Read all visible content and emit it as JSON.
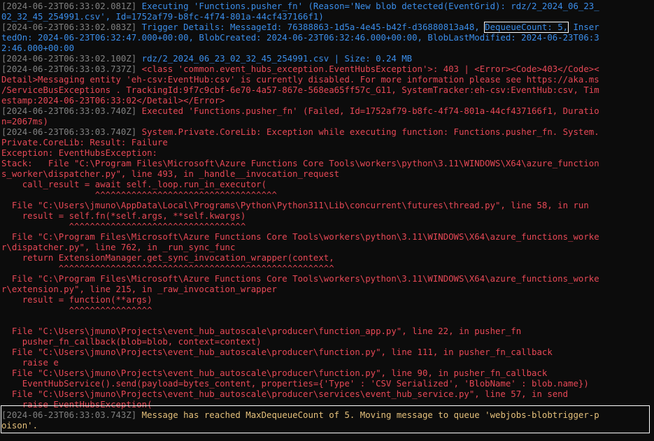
{
  "terminal": {
    "executing": {
      "ts": "[2024-06-23T06:33:02.081Z]",
      "line1": " Executing 'Functions.pusher_fn' (Reason='New blob detected(EventGrid): rdz/2_2024_06_23_",
      "line2": "02_32_45_254991.csv', Id=1752af79-b8fc-4f74-801a-44cf437166f1)"
    },
    "trigger": {
      "ts": "[2024-06-23T06:33:02.083Z]",
      "pre": " Trigger Details: MessageId: 76388863-1d5a-4e45-b42f-d36880813a48, ",
      "dequeue": "DequeueCount: 5,",
      "post": " Inser",
      "line2": "tedOn: 2024-06-23T06:32:47.000+00:00, BlobCreated: 2024-06-23T06:32:46.000+00:00, BlobLastModified: 2024-06-23T06:3",
      "line3": "2:46.000+00:00"
    },
    "blob": {
      "ts": "[2024-06-23T06:33:02.100Z]",
      "text": " rdz/2_2024_06_23_02_32_45_254991.csv | Size: 0.24 MB"
    },
    "exception": {
      "ts": "[2024-06-23T06:33:03.737Z]",
      "line1": " <class 'common.event_hubs_exception.EventHubsException'>: 403 | <Error><Code>403</Code><",
      "line2": "Detail>Messaging entity 'eh-csv:EventHub:csv' is currently disabled. For more information please see https://aka.ms",
      "line3": "/ServiceBusExceptions . TrackingId:9f7c9cbf-6e70-4a57-867e-568ea65ff57c_G11, SystemTracker:eh-csv:EventHub:csv, Tim",
      "line4": "estamp:2024-06-23T06:33:02</Detail></Error>"
    },
    "executed": {
      "ts": "[2024-06-23T06:33:03.740Z]",
      "line1": " Executed 'Functions.pusher_fn' (Failed, Id=1752af79-b8fc-4f74-801a-44cf437166f1, Duratio",
      "line2": "n=2067ms)"
    },
    "system": {
      "ts": "[2024-06-23T06:33:03.740Z]",
      "line1": " System.Private.CoreLib: Exception while executing function: Functions.pusher_fn. System.",
      "lines": [
        "Private.CoreLib: Result: Failure",
        "Exception: EventHubsException:",
        "Stack:   File \"C:\\Program Files\\Microsoft\\Azure Functions Core Tools\\workers\\python\\3.11\\WINDOWS\\X64\\azure_function",
        "s_worker\\dispatcher.py\", line 493, in _handle__invocation_request",
        "    call_result = await self._loop.run_in_executor(",
        "                  ^^^^^^^^^^^^^^^^^^^^^^^^^^^^^^^^^^^",
        "  File \"C:\\Users\\jmuno\\AppData\\Local\\Programs\\Python\\Python311\\Lib\\concurrent\\futures\\thread.py\", line 58, in run",
        "    result = self.fn(*self.args, **self.kwargs)",
        "             ^^^^^^^^^^^^^^^^^^^^^^^^^^^^^^^^^^",
        "  File \"C:\\Program Files\\Microsoft\\Azure Functions Core Tools\\workers\\python\\3.11\\WINDOWS\\X64\\azure_functions_worke",
        "r\\dispatcher.py\", line 762, in _run_sync_func",
        "    return ExtensionManager.get_sync_invocation_wrapper(context,",
        "           ^^^^^^^^^^^^^^^^^^^^^^^^^^^^^^^^^^^^^^^^^^^^^^^^^^^^^",
        "  File \"C:\\Program Files\\Microsoft\\Azure Functions Core Tools\\workers\\python\\3.11\\WINDOWS\\X64\\azure_functions_worke",
        "r\\extension.py\", line 215, in _raw_invocation_wrapper",
        "    result = function(**args)",
        "             ^^^^^^^^^^^^^^^^",
        "",
        "  File \"C:\\Users\\jmuno\\Projects\\event_hub_autoscale\\producer\\function_app.py\", line 22, in pusher_fn",
        "    pusher_fn_callback(blob=blob, context=context)",
        "  File \"C:\\Users\\jmuno\\Projects\\event_hub_autoscale\\producer\\function.py\", line 111, in pusher_fn_callback",
        "    raise e",
        "  File \"C:\\Users\\jmuno\\Projects\\event_hub_autoscale\\producer\\function.py\", line 90, in pusher_fn_callback",
        "    EventHubService().send(payload=bytes_content, properties={'Type' : 'CSV Serialized', 'BlobName' : blob.name})",
        "  File \"C:\\Users\\jmuno\\Projects\\event_hub_autoscale\\producer\\services\\event_hub_service.py\", line 57, in send",
        "    raise EventHubsException("
      ]
    },
    "final": {
      "ts": "[2024-06-23T06:33:03.743Z]",
      "line1": " Message has reached MaxDequeueCount of 5. Moving message to queue 'webjobs-blobtrigger-p",
      "line2": "oison'."
    },
    "colors": {
      "background": "#0c0c0c",
      "timestamp": "#808080",
      "info": "#3b8eea",
      "error": "#e74856",
      "warning": "#e5c07b"
    }
  }
}
